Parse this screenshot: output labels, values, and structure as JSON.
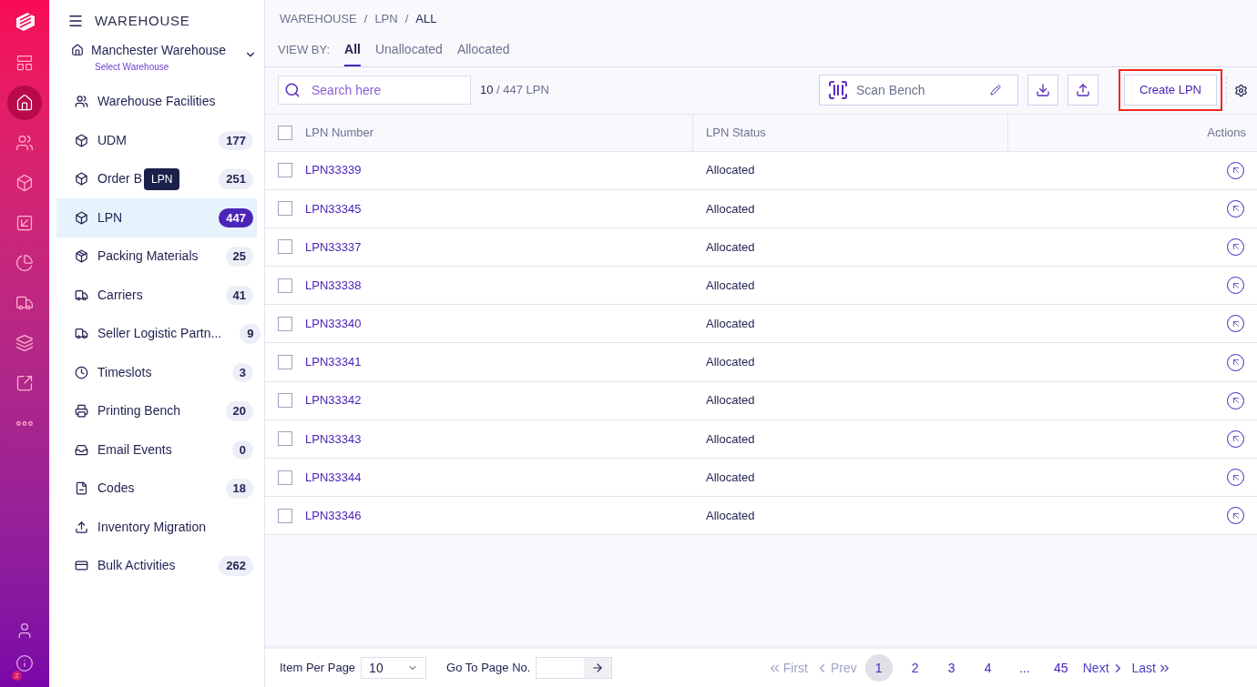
{
  "rail": {
    "items": [
      {
        "selected": false
      },
      {
        "selected": true
      },
      {
        "selected": false
      },
      {
        "selected": false
      },
      {
        "selected": false
      },
      {
        "selected": false
      },
      {
        "selected": false
      },
      {
        "selected": false
      },
      {
        "selected": false
      },
      {
        "selected": false
      }
    ],
    "info_badge": "2"
  },
  "nav": {
    "title": "WAREHOUSE",
    "warehouse": {
      "name": "Manchester Warehouse",
      "hint": "Select Warehouse"
    },
    "items": [
      {
        "label": "Warehouse Facilities",
        "selected": false
      },
      {
        "label": "UDM",
        "count": "177",
        "selected": false
      },
      {
        "label": "Order B",
        "count": "251",
        "selected": false,
        "tooltip": "LPN"
      },
      {
        "label": "LPN",
        "count": "447",
        "selected": true
      },
      {
        "label": "Packing Materials",
        "count": "25",
        "selected": false
      },
      {
        "label": "Carriers",
        "count": "41",
        "selected": false
      },
      {
        "label": "Seller Logistic Partn...",
        "count": "9",
        "selected": false
      },
      {
        "label": "Timeslots",
        "count": "3",
        "selected": false
      },
      {
        "label": "Printing Bench",
        "count": "20",
        "selected": false
      },
      {
        "label": "Email Events",
        "count": "0",
        "selected": false
      },
      {
        "label": "Codes",
        "count": "18",
        "selected": false
      },
      {
        "label": "Inventory Migration",
        "selected": false
      },
      {
        "label": "Bulk Activities",
        "count": "262",
        "selected": false
      }
    ]
  },
  "breadcrumb": {
    "separator": "/",
    "items": [
      "WAREHOUSE",
      "LPN",
      "ALL"
    ]
  },
  "view_by": {
    "label": "VIEW BY:",
    "tabs": [
      {
        "label": "All",
        "selected": true
      },
      {
        "label": "Unallocated",
        "selected": false
      },
      {
        "label": "Allocated",
        "selected": false
      }
    ]
  },
  "toolbar": {
    "search_placeholder": "Search here",
    "shown": "10",
    "total": "/ 447 LPN",
    "scan_bench": "Scan Bench",
    "create_button": "Create LPN",
    "create_highlighted": true
  },
  "table": {
    "columns": [
      "LPN Number",
      "LPN Status",
      "Actions"
    ],
    "header_checked": false,
    "rows": [
      {
        "lpn": "LPN33339",
        "status": "Allocated",
        "checked": false
      },
      {
        "lpn": "LPN33345",
        "status": "Allocated",
        "checked": false
      },
      {
        "lpn": "LPN33337",
        "status": "Allocated",
        "checked": false
      },
      {
        "lpn": "LPN33338",
        "status": "Allocated",
        "checked": false
      },
      {
        "lpn": "LPN33340",
        "status": "Allocated",
        "checked": false
      },
      {
        "lpn": "LPN33341",
        "status": "Allocated",
        "checked": false
      },
      {
        "lpn": "LPN33342",
        "status": "Allocated",
        "checked": false
      },
      {
        "lpn": "LPN33343",
        "status": "Allocated",
        "checked": false
      },
      {
        "lpn": "LPN33344",
        "status": "Allocated",
        "checked": false
      },
      {
        "lpn": "LPN33346",
        "status": "Allocated",
        "checked": false
      }
    ]
  },
  "footer": {
    "per_page_label": "Item Per Page",
    "per_page": "10",
    "goto_label": "Go To Page No.",
    "first": {
      "label": "First",
      "disabled": true
    },
    "prev": {
      "label": "Prev",
      "disabled": true
    },
    "pages": [
      {
        "label": "1",
        "selected": true
      },
      {
        "label": "2",
        "selected": false
      },
      {
        "label": "3",
        "selected": false
      },
      {
        "label": "4",
        "selected": false
      },
      {
        "label": "...",
        "selected": false
      },
      {
        "label": "45",
        "selected": false
      }
    ],
    "next": {
      "label": "Next",
      "disabled": false
    },
    "last": {
      "label": "Last",
      "disabled": false
    }
  }
}
